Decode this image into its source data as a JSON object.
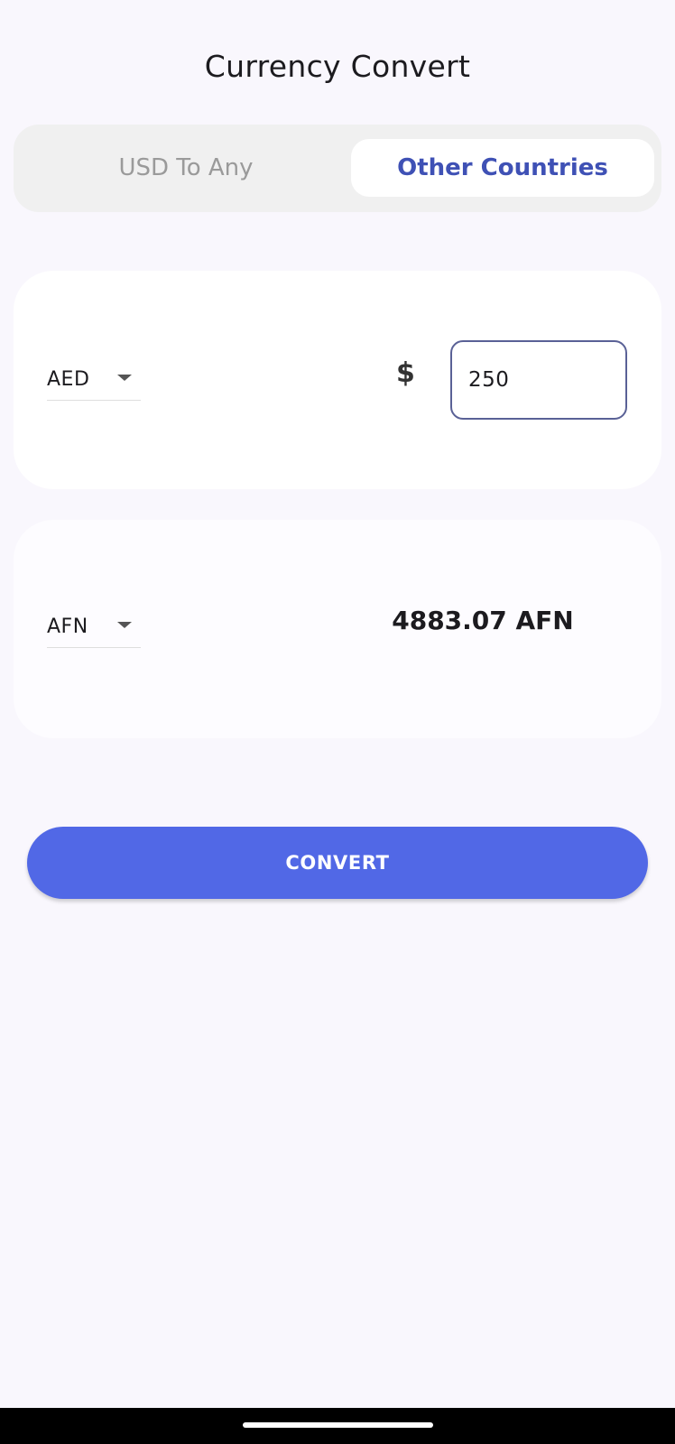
{
  "header": {
    "title": "Currency Convert"
  },
  "tabs": {
    "items": [
      "USD To Any",
      "Other Countries"
    ],
    "selected": "Other Countries"
  },
  "from_card": {
    "currency": "AED",
    "currency_icon": "dollar-sign",
    "amount": "250"
  },
  "to_card": {
    "currency": "AFN",
    "result": "4883.07 AFN"
  },
  "actions": {
    "convert_label": "CONVERT"
  },
  "colors": {
    "accent": "#3f51b5",
    "button": "#5168e6",
    "background": "#f9f7fd",
    "input_border": "#5a6196"
  }
}
